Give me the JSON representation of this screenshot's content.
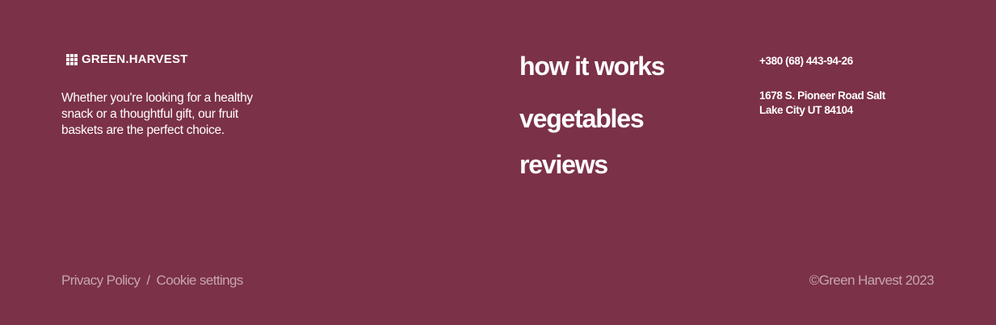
{
  "brand": {
    "name": "GREEN.HARVEST",
    "icon": "grid-dots-icon"
  },
  "tagline": "Whether you're looking for a healthy snack or a thoughtful gift, our fruit baskets are the perfect choice.",
  "nav": {
    "items": [
      {
        "label": "how it works"
      },
      {
        "label": "vegetables"
      },
      {
        "label": "reviews"
      }
    ]
  },
  "contact": {
    "phone": "+380 (68) 443-94-26",
    "address": "1678 S. Pioneer Road Salt Lake City UT 84104"
  },
  "legal": {
    "privacy": "Privacy Policy",
    "separator": "/",
    "cookies": "Cookie settings"
  },
  "copyright": "©Green Harvest 2023",
  "colors": {
    "background": "#7b3148",
    "text": "#ffffff",
    "muted": "#c7a5b1"
  }
}
